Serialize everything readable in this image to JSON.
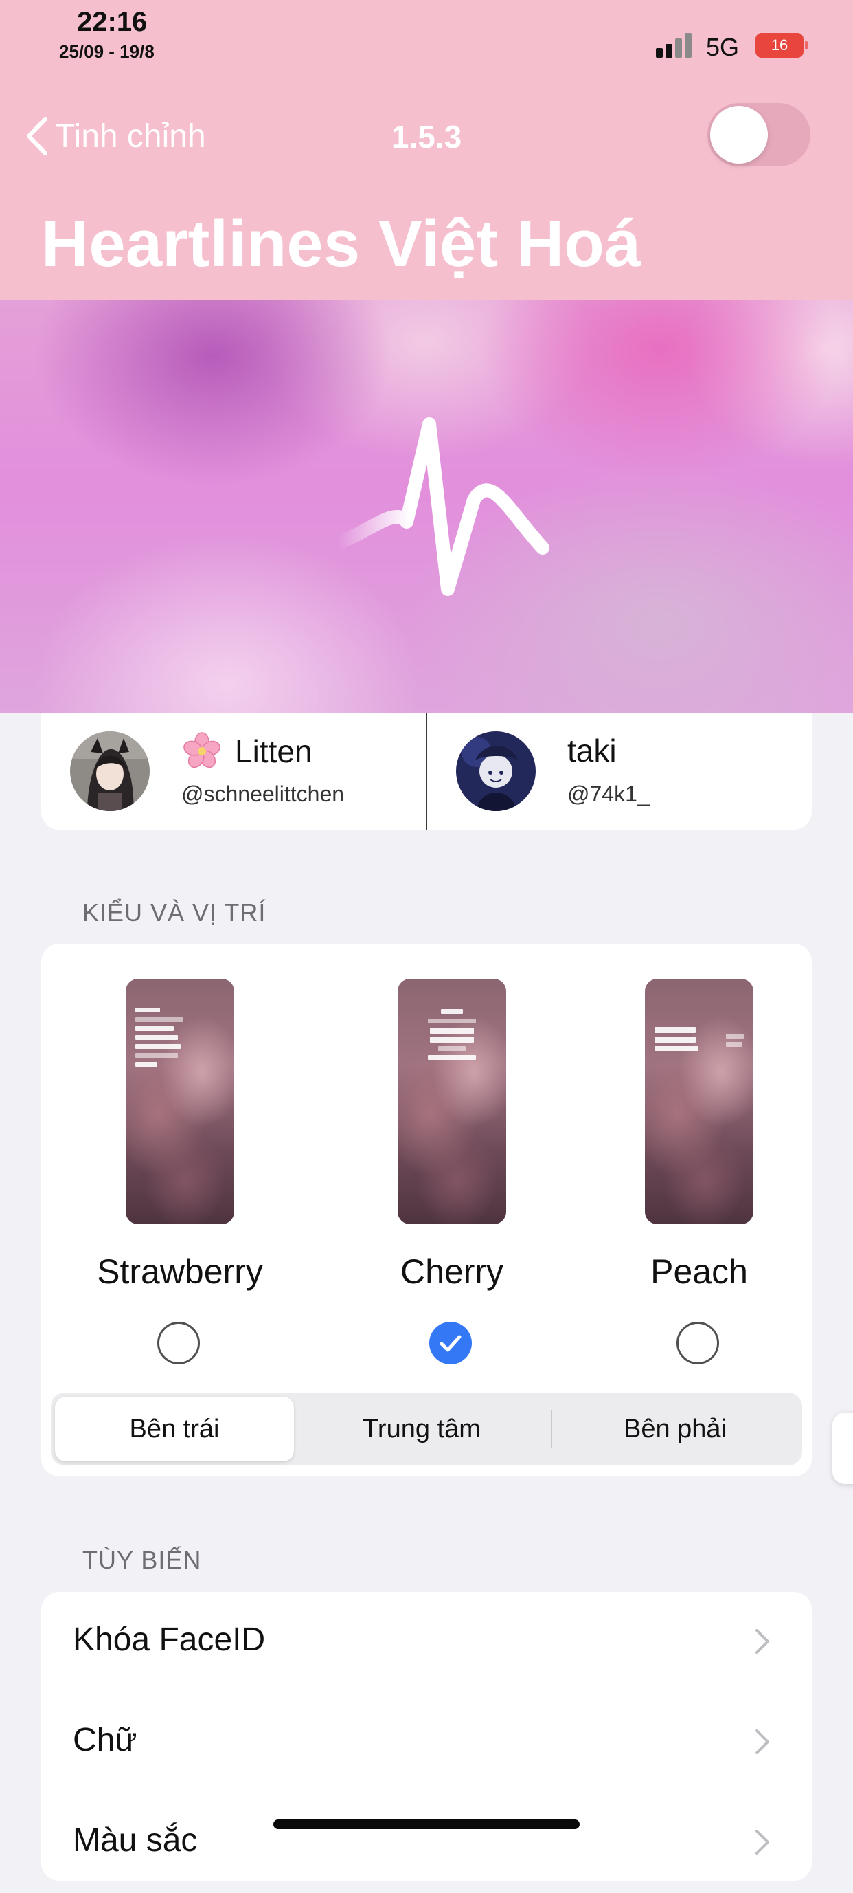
{
  "status_bar": {
    "time": "22:16",
    "date": "25/09 - 19/8",
    "network": "5G",
    "battery": "16",
    "battery_color": "#e8453c",
    "signal_bars_active": 2
  },
  "nav": {
    "back_label": "Tinh chỉnh",
    "version": "1.5.3",
    "toggle_on": false,
    "title": "Heartlines Việt Hoá",
    "bar_color": "#f5bfce"
  },
  "hero": {
    "icon": "heartbeat-icon"
  },
  "credits": [
    {
      "emoji_icon": "cherry-blossom-icon",
      "name": "Litten",
      "handle": "@schneelittchen"
    },
    {
      "name": "taki",
      "handle": "@74k1_"
    }
  ],
  "style_section": {
    "header": "KIỂU VÀ VỊ TRÍ",
    "styles": [
      {
        "label": "Strawberry",
        "selected": false
      },
      {
        "label": "Cherry",
        "selected": true
      },
      {
        "label": "Peach",
        "selected": false
      }
    ],
    "positions": [
      {
        "label": "Bên trái",
        "selected": true
      },
      {
        "label": "Trung tâm",
        "selected": false
      },
      {
        "label": "Bên phải",
        "selected": false
      }
    ],
    "accent_color": "#3478f6"
  },
  "customize_section": {
    "header": "TÙY BIẾN",
    "items": [
      {
        "label": "Khóa FaceID"
      },
      {
        "label": "Chữ"
      },
      {
        "label": "Màu sắc"
      }
    ]
  }
}
